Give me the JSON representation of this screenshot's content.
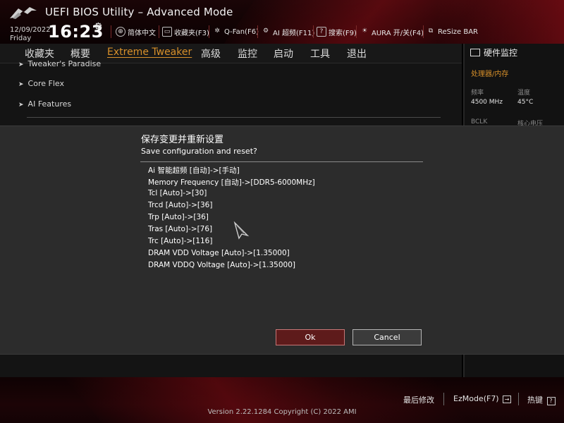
{
  "app": {
    "title": "UEFI BIOS Utility – Advanced Mode"
  },
  "clock": {
    "date": "12/09/2022",
    "day": "Friday",
    "time": "16:23"
  },
  "toolbar": [
    {
      "label": "简体中文",
      "icon": "globe-icon"
    },
    {
      "label": "收藏夹(F3)",
      "icon": "favorites-icon"
    },
    {
      "label": "Q-Fan(F6)",
      "icon": "fan-icon"
    },
    {
      "label": "AI 超频(F11)",
      "icon": "ai-icon"
    },
    {
      "label": "搜索(F9)",
      "icon": "search-icon"
    },
    {
      "label": "AURA 开/关(F4)",
      "icon": "aura-icon"
    },
    {
      "label": "ReSize BAR",
      "icon": "resize-bar-icon"
    }
  ],
  "nav": {
    "tabs": [
      {
        "label": "收藏夹"
      },
      {
        "label": "概要"
      },
      {
        "label": "Extreme Tweaker",
        "active": true
      },
      {
        "label": "高级"
      },
      {
        "label": "监控"
      },
      {
        "label": "启动"
      },
      {
        "label": "工具"
      },
      {
        "label": "退出"
      }
    ]
  },
  "main": {
    "items": [
      {
        "label": "Tweaker's Paradise"
      },
      {
        "label": "Core Flex"
      },
      {
        "label": "AI Features"
      }
    ]
  },
  "side": {
    "title": "硬件监控",
    "section": "处理器/内存",
    "freq_label": "频率",
    "freq_value": "4500 MHz",
    "temp_label": "温度",
    "temp_value": "45°C",
    "bclk_label": "BCLK",
    "vcore_label": "核心电压"
  },
  "modal": {
    "title": "保存变更并重新设置",
    "subtitle": "Save configuration and reset?",
    "changes": [
      "Ai 智能超频 [自动]->[手动]",
      "Memory Frequency [自动]->[DDR5-6000MHz]",
      "Tcl [Auto]->[30]",
      "Trcd [Auto]->[36]",
      "Trp [Auto]->[36]",
      "Tras [Auto]->[76]",
      "Trc [Auto]->[116]",
      "DRAM VDD Voltage [Auto]->[1.35000]",
      "DRAM VDDQ Voltage [Auto]->[1.35000]"
    ],
    "ok_label": "Ok",
    "cancel_label": "Cancel"
  },
  "footer": {
    "last_modified": "最后修改",
    "ezmode": "EzMode(F7)",
    "hotkeys": "热键",
    "version": "Version 2.22.1284 Copyright (C) 2022 AMI"
  },
  "colors": {
    "accent": "#d8902a",
    "brand_red": "#8c0e16",
    "ok_button": "#5e1b1b",
    "dialog_bg": "#2c2c2c"
  }
}
